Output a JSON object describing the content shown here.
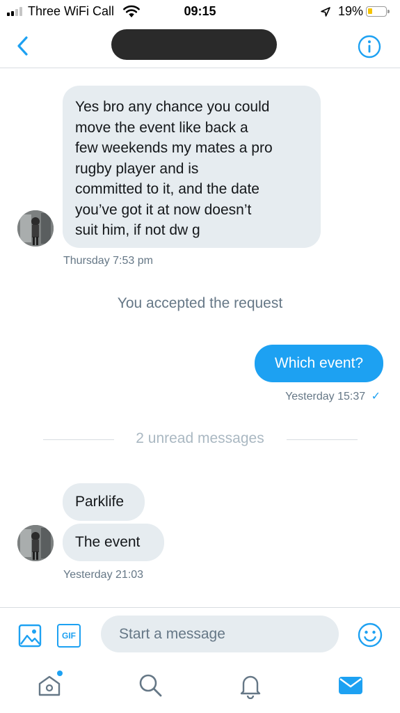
{
  "status_bar": {
    "carrier": "Three WiFi Call",
    "time": "09:15",
    "battery": "19%",
    "battery_level": 0.19,
    "signal_bars": 2,
    "signal_total": 4,
    "icons": [
      "signal-icon",
      "wifi-icon",
      "location-icon",
      "battery-icon"
    ]
  },
  "header": {
    "title_redacted": true,
    "icons": [
      "back-chevron-icon",
      "info-icon"
    ]
  },
  "conversation": {
    "message_1": {
      "direction": "incoming",
      "lines": [
        "Yes bro any chance you could",
        "move the event like back a",
        "few weekends my mates a pro",
        "rugby player and is",
        "committed to it, and the date",
        "you’ve got it at now doesn’t",
        "suit him, if not dw g"
      ],
      "timestamp": "Thursday 7:53 pm"
    },
    "system_note": "You accepted the request",
    "message_2": {
      "direction": "outgoing",
      "text": "Which event?",
      "timestamp": "Yesterday 15:37",
      "read_mark": "✓"
    },
    "unread_divider": "2 unread messages",
    "message_3": {
      "direction": "incoming",
      "text": "Parklife"
    },
    "message_4": {
      "direction": "incoming",
      "text": "The event",
      "timestamp": "Yesterday 21:03"
    }
  },
  "composer": {
    "placeholder": "Start a message",
    "value": "",
    "gif_label": "GIF",
    "icons": [
      "image-icon",
      "gif-icon",
      "emoji-icon"
    ]
  },
  "tabbar": {
    "tabs": [
      "home",
      "search",
      "notifications",
      "messages"
    ],
    "active": "messages",
    "home_has_new": true
  },
  "colors": {
    "accent": "#1da1f2",
    "incoming_bubble": "#e6ecf0",
    "meta_text": "#657786",
    "unread_text": "#aab8c2",
    "battery_fill": "#f5c400"
  }
}
